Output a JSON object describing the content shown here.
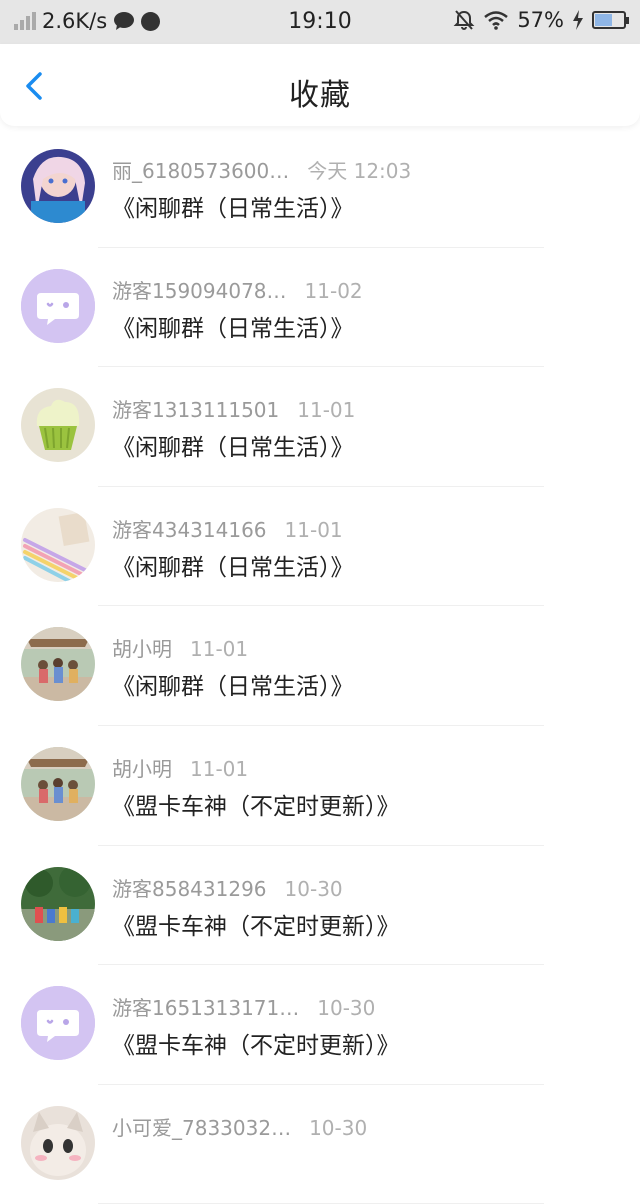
{
  "status_bar": {
    "speed": "2.6K/s",
    "time": "19:10",
    "battery": "57%",
    "battery_level": 0.57
  },
  "nav": {
    "title": "收藏"
  },
  "items": [
    {
      "name": "丽_6180573600…",
      "time": "今天 12:03",
      "message": "《闲聊群（日常生活）》",
      "avatar": "anime-girl"
    },
    {
      "name": "游客159094078…",
      "time": "11-02",
      "message": "《闲聊群（日常生活）》",
      "avatar": "guest"
    },
    {
      "name": "游客1313111501",
      "time": "11-01",
      "message": "《闲聊群（日常生活）》",
      "avatar": "cupcake"
    },
    {
      "name": "游客434314166",
      "time": "11-01",
      "message": "《闲聊群（日常生活）》",
      "avatar": "pens"
    },
    {
      "name": "胡小明",
      "time": "11-01",
      "message": "《闲聊群（日常生活）》",
      "avatar": "group-photo"
    },
    {
      "name": "胡小明",
      "time": "11-01",
      "message": "《盟卡车神（不定时更新）》",
      "avatar": "group-photo"
    },
    {
      "name": "游客858431296",
      "time": "10-30",
      "message": "《盟卡车神（不定时更新）》",
      "avatar": "kids-outdoor"
    },
    {
      "name": "游客1651313171…",
      "time": "10-30",
      "message": "《盟卡车神（不定时更新）》",
      "avatar": "guest"
    },
    {
      "name": "小可爱_7833032…",
      "time": "10-30",
      "message": "",
      "avatar": "cat"
    }
  ]
}
